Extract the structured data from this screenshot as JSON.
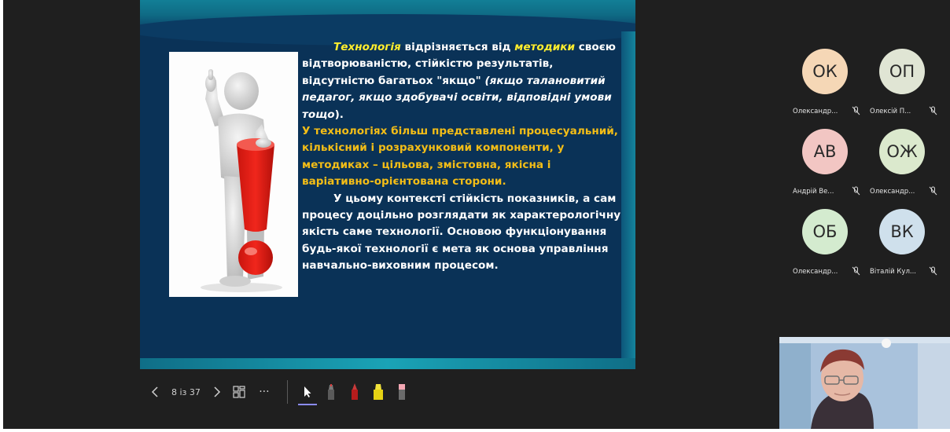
{
  "slide": {
    "para1": {
      "hl1": "Технологія",
      "t1": " відрізняється від ",
      "hl2": "методики",
      "t2": " своєю відтворюваністю, стійкістю результатів, відсутністю багатьох \"якщо\" ",
      "it": "(якщо талановитий педагог, якщо здобувачі освіти, відповідні умови тощо",
      "t3": ")."
    },
    "para2": "У технологіях більш представлені процесуальний, кількісний і розрахунковий компоненти, у методиках – цільова, змістовна, якісна і варіативно-орієнтована сторони.",
    "para3": "У цьому контексті стійкість показників, а сам процесу доцільно розглядати як характерологічну якість саме технології. Основою функціонування будь-якої технології є мета як основа управління навчально-виховним процесом."
  },
  "toolbar": {
    "page_indicator": "8 із 37",
    "more_label": "···"
  },
  "participants": [
    {
      "initials": "ОК",
      "name": "Олександр...",
      "color": "#f5d7b6"
    },
    {
      "initials": "ОП",
      "name": "Олексій П...",
      "color": "#e0e5d4"
    },
    {
      "initials": "АВ",
      "name": "Андрій Ве...",
      "color": "#f2c6c3"
    },
    {
      "initials": "ОЖ",
      "name": "Олександр...",
      "color": "#dbe9cd"
    },
    {
      "initials": "ОБ",
      "name": "Олександр...",
      "color": "#d4ebcf"
    },
    {
      "initials": "ВК",
      "name": "Віталій Кул...",
      "color": "#cfe0ec"
    }
  ],
  "colors": {
    "slide_bg": "#0a3257",
    "highlight_yellow": "#ffee2e",
    "orange_text": "#f3bd17",
    "active_tool_underline": "#8b8cf7"
  },
  "icons": [
    "chevron-left-icon",
    "chevron-right-icon",
    "grid-view-icon",
    "more-icon",
    "pointer-icon",
    "pen-dark-icon",
    "pen-red-icon",
    "highlighter-yellow-icon",
    "eraser-icon",
    "mic-off-icon"
  ]
}
